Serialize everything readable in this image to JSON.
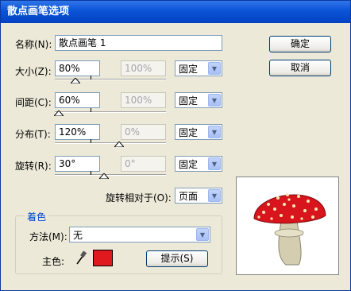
{
  "window": {
    "title": "散点画笔选项"
  },
  "name": {
    "label": "名称(N):",
    "value": "散点画笔 1"
  },
  "size": {
    "label": "大小(Z):",
    "value": "80%",
    "max_value": "100%",
    "mode": "固定",
    "level": 0.8
  },
  "spacing": {
    "label": "间距(C):",
    "value": "60%",
    "max_value": "100%",
    "mode": "固定",
    "level": 0.6
  },
  "scatter": {
    "label": "分布(T):",
    "value": "120%",
    "max_value": "0%",
    "mode": "固定",
    "level": 0.55
  },
  "rotation": {
    "label": "旋转(R):",
    "value": "30°",
    "max_value": "0°",
    "mode": "固定",
    "level": 0.55
  },
  "rotation_relative": {
    "label": "旋转相对于(O):",
    "value": "页面"
  },
  "colorization": {
    "group_title": "着色",
    "method_label": "方法(M):",
    "method_value": "无",
    "key_color_label": "主色:",
    "key_color": "#e0191f",
    "tips_button": "提示(S)"
  },
  "buttons": {
    "ok": "确定",
    "cancel": "取消"
  },
  "colors": {
    "title_bar": "#0a53d6",
    "dialog_bg": "#ece9d8",
    "mushroom_cap": "#d8141c",
    "mushroom_stem": "#c9c3a5"
  }
}
